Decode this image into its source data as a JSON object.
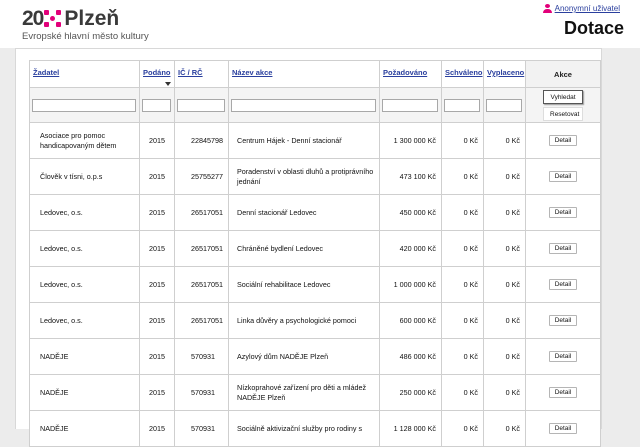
{
  "header": {
    "logo_number": "2015",
    "logo_city": "Plzeň",
    "tagline": "Evropské hlavní město kultury",
    "user_link": "Anonymní uživatel",
    "page_title": "Dotace",
    "accent_color": "#e2007a"
  },
  "table": {
    "columns": {
      "zadatel": "Žadatel",
      "podano": "Podáno",
      "ic": "IČ / RČ",
      "nazev": "Název akce",
      "pozadovano": "Požadováno",
      "schvaleno": "Schváleno",
      "vyplaceno": "Vyplaceno",
      "akce": "Akce"
    },
    "filters": {
      "find_button": "Vyhledat",
      "reset_button": "Resetovat"
    },
    "detail_label": "Detail",
    "rows": [
      {
        "zadatel": "Asociace pro pomoc handicapovaným dětem",
        "podano": "2015",
        "ic": "22845798",
        "nazev": "Centrum Hájek - Denní stacionář",
        "pozadovano": "1 300 000 Kč",
        "schvaleno": "0 Kč",
        "vyplaceno": "0 Kč"
      },
      {
        "zadatel": "Člověk v tísni, o.p.s",
        "podano": "2015",
        "ic": "25755277",
        "nazev": "Poradenství v oblasti dluhů a protiprávního jednání",
        "pozadovano": "473 100 Kč",
        "schvaleno": "0 Kč",
        "vyplaceno": "0 Kč"
      },
      {
        "zadatel": "Ledovec, o.s.",
        "podano": "2015",
        "ic": "26517051",
        "nazev": "Denní stacionář Ledovec",
        "pozadovano": "450 000 Kč",
        "schvaleno": "0 Kč",
        "vyplaceno": "0 Kč"
      },
      {
        "zadatel": "Ledovec, o.s.",
        "podano": "2015",
        "ic": "26517051",
        "nazev": "Chráněné bydlení Ledovec",
        "pozadovano": "420 000 Kč",
        "schvaleno": "0 Kč",
        "vyplaceno": "0 Kč"
      },
      {
        "zadatel": "Ledovec, o.s.",
        "podano": "2015",
        "ic": "26517051",
        "nazev": "Sociální rehabilitace Ledovec",
        "pozadovano": "1 000 000 Kč",
        "schvaleno": "0 Kč",
        "vyplaceno": "0 Kč"
      },
      {
        "zadatel": "Ledovec, o.s.",
        "podano": "2015",
        "ic": "26517051",
        "nazev": "Linka důvěry a psychologické pomoci",
        "pozadovano": "600 000 Kč",
        "schvaleno": "0 Kč",
        "vyplaceno": "0 Kč"
      },
      {
        "zadatel": "NADĚJE",
        "podano": "2015",
        "ic": "570931",
        "nazev": "Azylový dům NADĚJE Plzeň",
        "pozadovano": "486 000 Kč",
        "schvaleno": "0 Kč",
        "vyplaceno": "0 Kč"
      },
      {
        "zadatel": "NADĚJE",
        "podano": "2015",
        "ic": "570931",
        "nazev": "Nízkoprahové zařízení pro děti a mládež NADĚJE Plzeň",
        "pozadovano": "250 000 Kč",
        "schvaleno": "0 Kč",
        "vyplaceno": "0 Kč"
      },
      {
        "zadatel": "NADĚJE",
        "podano": "2015",
        "ic": "570931",
        "nazev": "Sociálně aktivizační služby pro rodiny s",
        "pozadovano": "1 128 000 Kč",
        "schvaleno": "0 Kč",
        "vyplaceno": "0 Kč"
      }
    ]
  }
}
